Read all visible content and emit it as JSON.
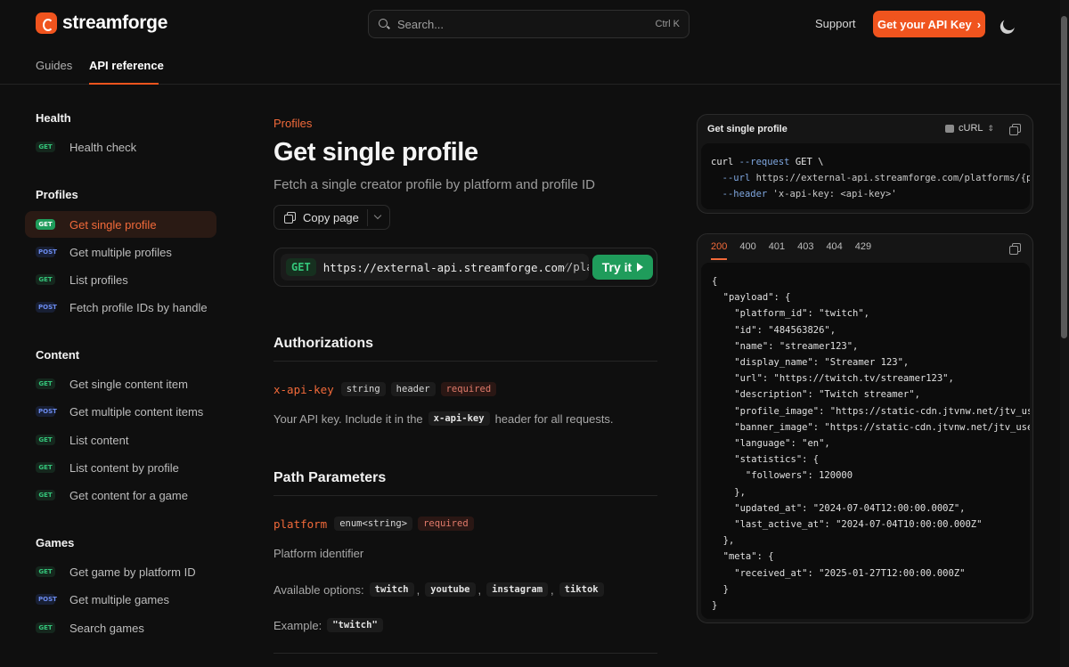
{
  "header": {
    "brand": "streamforge",
    "search_placeholder": "Search...",
    "search_shortcut": "Ctrl K",
    "support": "Support",
    "cta": "Get your API Key",
    "cta_chevron": "›",
    "tabs": [
      {
        "label": "Guides",
        "active": false
      },
      {
        "label": "API reference",
        "active": true
      }
    ]
  },
  "sidebar": {
    "sections": [
      {
        "title": "Health",
        "items": [
          {
            "method": "GET",
            "label": "Health check"
          }
        ]
      },
      {
        "title": "Profiles",
        "items": [
          {
            "method": "GET",
            "label": "Get single profile",
            "active": true
          },
          {
            "method": "POST",
            "label": "Get multiple profiles"
          },
          {
            "method": "GET",
            "label": "List profiles"
          },
          {
            "method": "POST",
            "label": "Fetch profile IDs by handle"
          }
        ]
      },
      {
        "title": "Content",
        "items": [
          {
            "method": "GET",
            "label": "Get single content item"
          },
          {
            "method": "POST",
            "label": "Get multiple content items"
          },
          {
            "method": "GET",
            "label": "List content"
          },
          {
            "method": "GET",
            "label": "List content by profile"
          },
          {
            "method": "GET",
            "label": "Get content for a game"
          }
        ]
      },
      {
        "title": "Games",
        "items": [
          {
            "method": "GET",
            "label": "Get game by platform ID"
          },
          {
            "method": "POST",
            "label": "Get multiple games"
          },
          {
            "method": "GET",
            "label": "Search games"
          }
        ]
      }
    ]
  },
  "main": {
    "eyebrow": "Profiles",
    "title": "Get single profile",
    "subtitle": "Fetch a single creator profile by platform and profile ID",
    "copy_page": "Copy page",
    "request": {
      "method": "GET",
      "url": "https://external-api.streamforge.com",
      "url_tail": "⁄/pla",
      "try_it": "Try it"
    },
    "authorizations": {
      "heading": "Authorizations",
      "param": {
        "name": "x-api-key",
        "type": "string",
        "location": "header",
        "required": "required"
      },
      "desc_before": "Your API key. Include it in the",
      "desc_code": "x-api-key",
      "desc_after": "header for all requests."
    },
    "path_params": {
      "heading": "Path Parameters",
      "param": {
        "name": "platform",
        "type": "enum<string>",
        "required": "required"
      },
      "desc": "Platform identifier",
      "options_label": "Available options:",
      "options": [
        "twitch",
        "youtube",
        "instagram",
        "tiktok"
      ],
      "example_label": "Example:",
      "example": "\"twitch\""
    }
  },
  "request_panel": {
    "title": "Get single profile",
    "language": "cURL",
    "lines": [
      [
        "curl ",
        "--request",
        " GET \\"
      ],
      [
        "  ",
        "--url",
        " https://external-api.streamforge.com/platforms/{pla"
      ],
      [
        "  ",
        "--header",
        " 'x-api-key: <api-key>'"
      ]
    ]
  },
  "response_panel": {
    "tabs": [
      "200",
      "400",
      "401",
      "403",
      "404",
      "429"
    ],
    "active_tab": "200",
    "lines": [
      "{",
      "  \"payload\": {",
      "    \"platform_id\": \"twitch\",",
      "    \"id\": \"484563826\",",
      "    \"name\": \"streamer123\",",
      "    \"display_name\": \"Streamer 123\",",
      "    \"url\": \"https://twitch.tv/streamer123\",",
      "    \"description\": \"Twitch streamer\",",
      "    \"profile_image\": \"https://static-cdn.jtvnw.net/jtv_user",
      "    \"banner_image\": \"https://static-cdn.jtvnw.net/jtv_user_",
      "    \"language\": \"en\",",
      "    \"statistics\": {",
      "      \"followers\": 120000",
      "    },",
      "    \"updated_at\": \"2024-07-04T12:00:00.000Z\",",
      "    \"last_active_at\": \"2024-07-04T10:00:00.000Z\"",
      "  },",
      "  \"meta\": {",
      "    \"received_at\": \"2025-01-27T12:00:00.000Z\"",
      "  }",
      "}"
    ]
  },
  "icons": {
    "logo": "streamforge-logo-icon",
    "search": "search-icon",
    "theme": "moon-icon",
    "copy": "copy-icon",
    "play": "play-icon"
  },
  "colors": {
    "accent": "#f0541e",
    "get": "#34c57a",
    "post": "#6c8cf0",
    "try_it": "#1f9c5b"
  }
}
